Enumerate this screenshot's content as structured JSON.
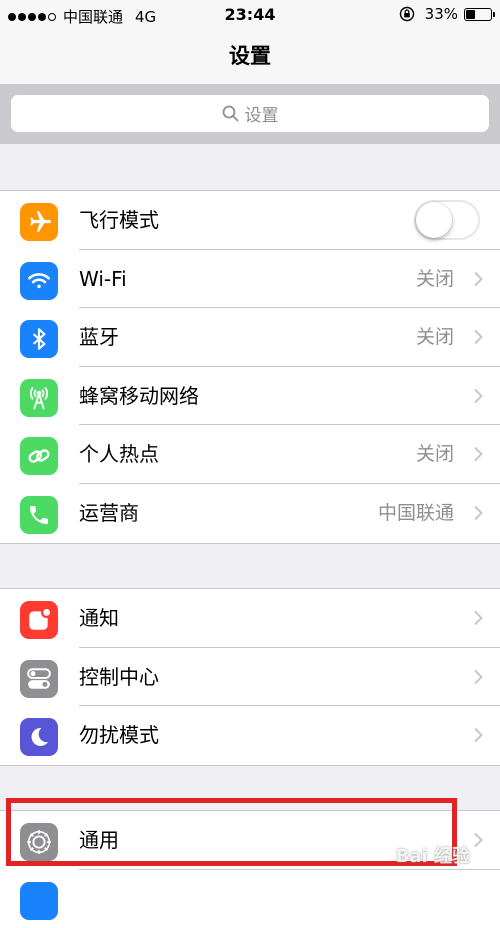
{
  "status_bar": {
    "carrier": "中国联通",
    "network": "4G",
    "time": "23:44",
    "battery": "33%",
    "battery_level": 0.33
  },
  "nav": {
    "title": "设置"
  },
  "search": {
    "placeholder": "设置"
  },
  "groups": [
    [
      {
        "label": "飞行模式",
        "icon": "airplane-icon",
        "color": "#ff9500",
        "toggle": false
      },
      {
        "label": "Wi-Fi",
        "icon": "wifi-icon",
        "color": "#1a82fb",
        "value": "关闭"
      },
      {
        "label": "蓝牙",
        "icon": "bluetooth-icon",
        "color": "#1a82fb",
        "value": "关闭"
      },
      {
        "label": "蜂窝移动网络",
        "icon": "cellular-icon",
        "color": "#4cd964"
      },
      {
        "label": "个人热点",
        "icon": "hotspot-icon",
        "color": "#4cd964",
        "value": "关闭"
      },
      {
        "label": "运营商",
        "icon": "phone-icon",
        "color": "#4cd964",
        "value": "中国联通"
      }
    ],
    [
      {
        "label": "通知",
        "icon": "notifications-icon",
        "color": "#ff3b30"
      },
      {
        "label": "控制中心",
        "icon": "control-center-icon",
        "color": "#8e8e93"
      },
      {
        "label": "勿扰模式",
        "icon": "moon-icon",
        "color": "#5856d6"
      }
    ],
    [
      {
        "label": "通用",
        "icon": "gear-icon",
        "color": "#8e8e93"
      }
    ]
  ],
  "watermark": "Bai 经验"
}
